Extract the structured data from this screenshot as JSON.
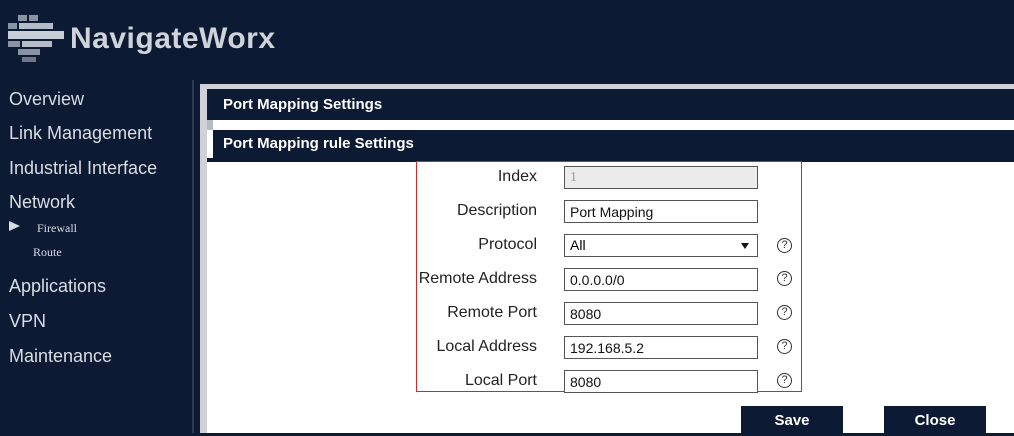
{
  "brand": {
    "name": "NavigateWorx"
  },
  "sidebar": {
    "items": [
      {
        "label": "Overview"
      },
      {
        "label": "Link Management"
      },
      {
        "label": "Industrial Interface"
      },
      {
        "label": "Network"
      },
      {
        "label": "Applications"
      },
      {
        "label": "VPN"
      },
      {
        "label": "Maintenance"
      }
    ],
    "network_sub": [
      {
        "label": "Firewall",
        "selected": true
      },
      {
        "label": "Route"
      }
    ]
  },
  "panel": {
    "title": "Port Mapping Settings",
    "subtitle": "Port Mapping rule Settings"
  },
  "form": {
    "index": {
      "label": "Index",
      "value": "1"
    },
    "description": {
      "label": "Description",
      "value": "Port Mapping"
    },
    "protocol": {
      "label": "Protocol",
      "value": "All"
    },
    "remote_address": {
      "label": "Remote Address",
      "value": "0.0.0.0/0"
    },
    "remote_port": {
      "label": "Remote Port",
      "value": "8080"
    },
    "local_address": {
      "label": "Local Address",
      "value": "192.168.5.2"
    },
    "local_port": {
      "label": "Local Port",
      "value": "8080"
    },
    "help_glyph": "?"
  },
  "buttons": {
    "save": "Save",
    "close": "Close"
  },
  "colors": {
    "navy": "#0d1a33",
    "highlight_border": "#dd2222"
  }
}
